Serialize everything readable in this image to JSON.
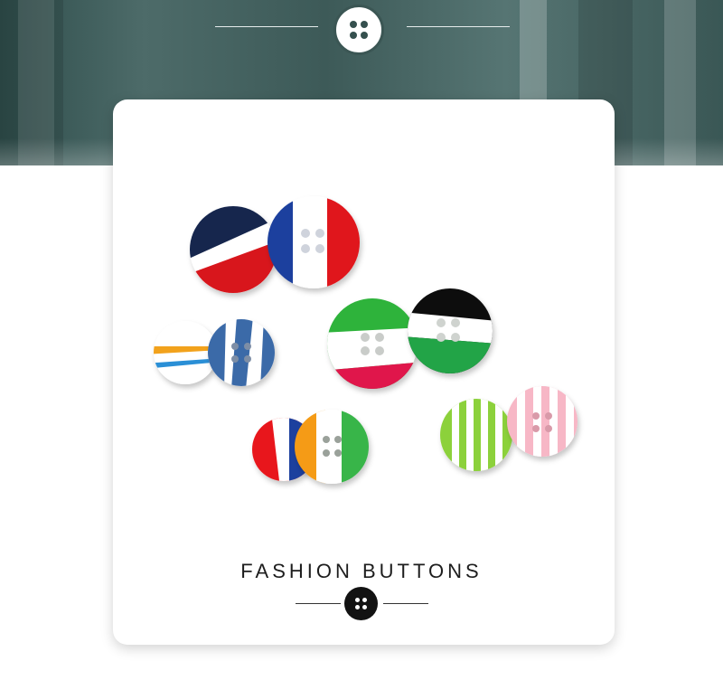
{
  "product": {
    "title": "FASHION BUTTONS"
  },
  "icons": {
    "top_badge": "four-hole-button-icon",
    "bottom_badge": "four-hole-button-icon"
  },
  "colors": {
    "hero_background": "#3d5a58",
    "card_background": "#ffffff",
    "title_text": "#1d1d1d",
    "bottom_badge": "#121212"
  },
  "button_styles": [
    "navy-white-red",
    "blue-white-red",
    "white-orange-blue-stripe",
    "blue-white-stripe",
    "green-white-red",
    "black-white-green",
    "red-white-blue",
    "orange-white-green",
    "green-white-stripe",
    "pink-white-stripe"
  ]
}
